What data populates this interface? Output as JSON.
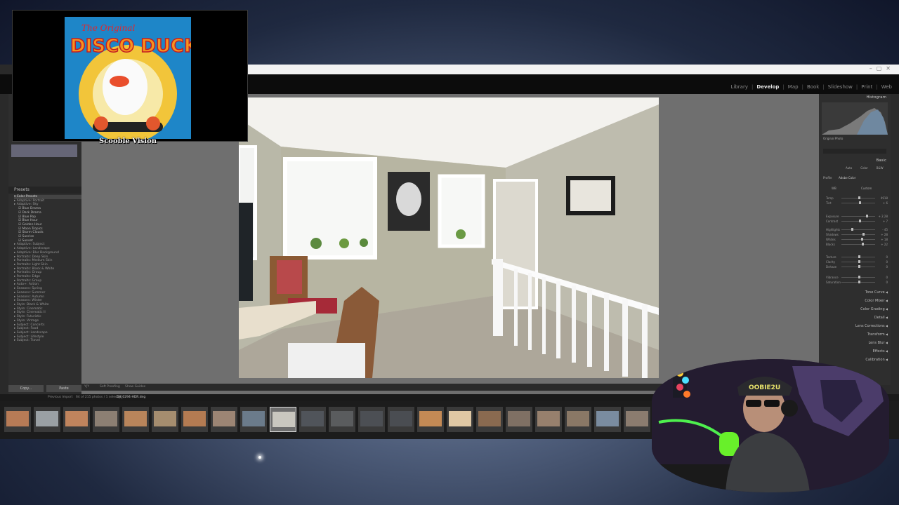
{
  "stream": {
    "overlay_caption": "Scooble Vision",
    "album_title_line1": "The Original",
    "album_title_line2": "DISCO DUCK",
    "webcam_cap_text": "OOBIE2U"
  },
  "lightroom": {
    "modules": [
      "Library",
      "Develop",
      "Map",
      "Book",
      "Slideshow",
      "Print",
      "Web"
    ],
    "active_module": "Develop",
    "left_panel": {
      "presets_header": "Presets",
      "preset_items": [
        {
          "label": "Color Presets",
          "type": "hl"
        },
        {
          "label": "Adaptive: Portrait",
          "type": "group"
        },
        {
          "label": "Adaptive: Sky",
          "type": "group"
        },
        {
          "label": "Blue Drama",
          "type": "sub"
        },
        {
          "label": "Dark Drama",
          "type": "sub"
        },
        {
          "label": "Blue Pop",
          "type": "sub"
        },
        {
          "label": "Blue Hour",
          "type": "sub"
        },
        {
          "label": "Golden Hour",
          "type": "sub"
        },
        {
          "label": "Moon Tropics",
          "type": "sub"
        },
        {
          "label": "Storm Clouds",
          "type": "sub"
        },
        {
          "label": "Sunrise",
          "type": "sub"
        },
        {
          "label": "Sunset",
          "type": "sub"
        },
        {
          "label": "Adaptive: Subject",
          "type": "group"
        },
        {
          "label": "Adaptive: Landscape",
          "type": "group"
        },
        {
          "label": "Adaptive: Blur Background",
          "type": "group"
        },
        {
          "label": "Portraits: Deep Skin",
          "type": "group"
        },
        {
          "label": "Portraits: Medium Skin",
          "type": "group"
        },
        {
          "label": "Portraits: Light Skin",
          "type": "group"
        },
        {
          "label": "Portraits: Black & White",
          "type": "group"
        },
        {
          "label": "Portraits: Group",
          "type": "group"
        },
        {
          "label": "Portraits: Edge",
          "type": "group"
        },
        {
          "label": "Portraits: Group",
          "type": "group"
        },
        {
          "label": "Auto+: Action",
          "type": "group"
        },
        {
          "label": "Seasons: Spring",
          "type": "group"
        },
        {
          "label": "Seasons: Summer",
          "type": "group"
        },
        {
          "label": "Seasons: Autumn",
          "type": "group"
        },
        {
          "label": "Seasons: Winter",
          "type": "group"
        },
        {
          "label": "Style: Black & White",
          "type": "group"
        },
        {
          "label": "Style: Cinematic",
          "type": "group"
        },
        {
          "label": "Style: Cinematic II",
          "type": "group"
        },
        {
          "label": "Style: Futuristic",
          "type": "group"
        },
        {
          "label": "Style: Vintage",
          "type": "group"
        },
        {
          "label": "Subject: Concerts",
          "type": "group"
        },
        {
          "label": "Subject: Food",
          "type": "group"
        },
        {
          "label": "Subject: Landscape",
          "type": "group"
        },
        {
          "label": "Subject: Lifestyle",
          "type": "group"
        },
        {
          "label": "Subject: Travel",
          "type": "group"
        }
      ],
      "copy_label": "Copy...",
      "paste_label": "Paste"
    },
    "toolbar": {
      "before_after": "Y|Y",
      "soft_proofing": "Soft Proofing",
      "show_guides": "Show Guides"
    },
    "right_panel": {
      "histogram_label": "Histogram",
      "original_photo": "Original Photo",
      "basic_label": "Basic",
      "treatment_auto": "Auto",
      "treatment_color": "Color",
      "treatment_bw": "B&W",
      "profile_label": "Profile",
      "profile_value": "Adobe Color",
      "wb_label": "WB",
      "wb_value": "Custom",
      "sliders": [
        {
          "label": "Temp",
          "value": "4918",
          "pos": 0.5
        },
        {
          "label": "Tint",
          "value": "+ 6",
          "pos": 0.52
        },
        {
          "label": "Exposure",
          "value": "+ 2.28",
          "pos": 0.72
        },
        {
          "label": "Contrast",
          "value": "+ 7",
          "pos": 0.52
        },
        {
          "label": "Highlights",
          "value": "- 45",
          "pos": 0.3
        },
        {
          "label": "Shadows",
          "value": "+ 28",
          "pos": 0.62
        },
        {
          "label": "Whites",
          "value": "+ 18",
          "pos": 0.58
        },
        {
          "label": "Blacks",
          "value": "+ 22",
          "pos": 0.6
        },
        {
          "label": "Texture",
          "value": "0",
          "pos": 0.5
        },
        {
          "label": "Clarity",
          "value": "0",
          "pos": 0.5
        },
        {
          "label": "Dehaze",
          "value": "0",
          "pos": 0.5
        },
        {
          "label": "Vibrance",
          "value": "0",
          "pos": 0.5
        },
        {
          "label": "Saturation",
          "value": "0",
          "pos": 0.5
        }
      ],
      "sections": [
        "Tone Curve",
        "Color Mixer",
        "Color Grading",
        "Detail",
        "Lens Corrections",
        "Transform",
        "Lens Blur",
        "Effects",
        "Calibration"
      ]
    },
    "filmstrip": {
      "source": "Previous Import",
      "info": "64 of 215 photos / 1 selected",
      "filename": "DJI_0294-HDR.dng",
      "thumb_colors": [
        "#b77b56",
        "#9aa0a4",
        "#c0845d",
        "#8c7f73",
        "#b9855b",
        "#a58d6f",
        "#b47b52",
        "#9c8574",
        "#6b7b8b",
        "#c9c7bf",
        "#50545a",
        "#5a5c5e",
        "#4c4f54",
        "#4a4d52",
        "#c48a55",
        "#e0c8a4",
        "#8a6a50",
        "#7f7064",
        "#97806d",
        "#8a7866",
        "#7a8ca0",
        "#8b7c6f"
      ]
    }
  }
}
